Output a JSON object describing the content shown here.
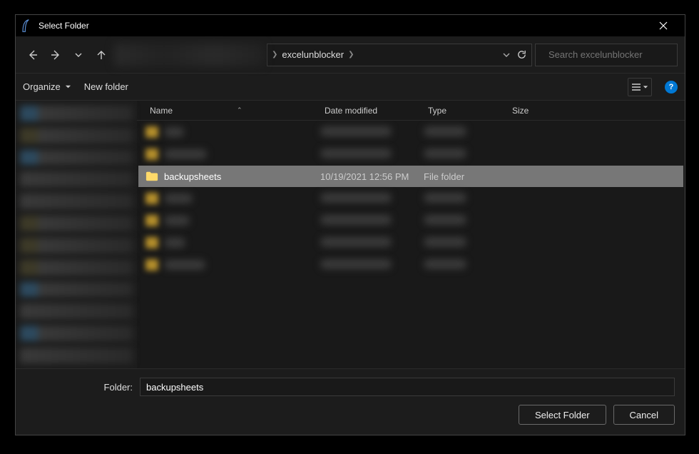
{
  "window": {
    "title": "Select Folder"
  },
  "nav": {
    "crumb_current": "excelunblocker",
    "search_placeholder": "Search excelunblocker"
  },
  "toolbar": {
    "organize": "Organize",
    "new_folder": "New folder"
  },
  "columns": {
    "name": "Name",
    "date": "Date modified",
    "type": "Type",
    "size": "Size"
  },
  "files": {
    "selected": {
      "name": "backupsheets",
      "date": "10/19/2021 12:56 PM",
      "type": "File folder"
    }
  },
  "footer": {
    "folder_label": "Folder:",
    "folder_value": "backupsheets",
    "select_btn": "Select Folder",
    "cancel_btn": "Cancel"
  }
}
